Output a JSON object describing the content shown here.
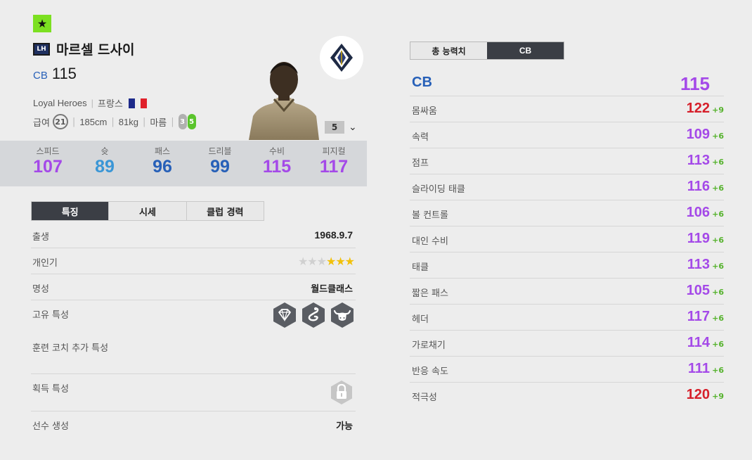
{
  "colors": {
    "red": "#d61f2a",
    "purple": "#a449e8",
    "blue": "#2760b8",
    "green": "#55b22c",
    "dark_tab": "#3b3e45"
  },
  "player": {
    "star_badge": "★",
    "season_code": "LH",
    "name": "마르셀 드사이",
    "position": "CB",
    "ovr": "115",
    "season_name": "Loyal Heroes",
    "nation": "프랑스",
    "wage_label": "급여",
    "wage": "21",
    "height": "185cm",
    "weight": "81kg",
    "build": "마름",
    "weak_foot": "3",
    "strong_foot": "5",
    "level": "5"
  },
  "summary_stats": [
    {
      "label": "스피드",
      "value": "107",
      "color": "#a449e8"
    },
    {
      "label": "슛",
      "value": "89",
      "color": "#3a96d6"
    },
    {
      "label": "패스",
      "value": "96",
      "color": "#2760b8"
    },
    {
      "label": "드리블",
      "value": "99",
      "color": "#2760b8"
    },
    {
      "label": "수비",
      "value": "115",
      "color": "#a449e8"
    },
    {
      "label": "피지컬",
      "value": "117",
      "color": "#a449e8"
    }
  ],
  "left_tabs": [
    "특징",
    "시세",
    "클럽 경력"
  ],
  "details": {
    "birth_label": "출생",
    "birth_value": "1968.9.7",
    "popularity_label": "개인기",
    "popularity_stars": 3,
    "popularity_max": 6,
    "reputation_label": "명성",
    "reputation_value": "월드클래스",
    "unique_trait_label": "고유 특성",
    "unique_trait_icons": [
      "diamond-icon",
      "snake-icon",
      "bull-icon"
    ],
    "coach_trait_label": "훈련 코치 추가 특성",
    "acquired_trait_label": "획득 특성",
    "generation_label": "선수 생성",
    "generation_value": "가능"
  },
  "right_tabs": [
    "총 능력치",
    "CB"
  ],
  "position_ovr": {
    "label": "CB",
    "value": "115"
  },
  "attributes": [
    {
      "label": "몸싸움",
      "value": "122",
      "bonus": "+9",
      "color": "#d61f2a"
    },
    {
      "label": "속력",
      "value": "109",
      "bonus": "+6",
      "color": "#a449e8"
    },
    {
      "label": "점프",
      "value": "113",
      "bonus": "+6",
      "color": "#a449e8"
    },
    {
      "label": "슬라이딩 태클",
      "value": "116",
      "bonus": "+6",
      "color": "#a449e8"
    },
    {
      "label": "볼 컨트롤",
      "value": "106",
      "bonus": "+6",
      "color": "#a449e8"
    },
    {
      "label": "대인 수비",
      "value": "119",
      "bonus": "+6",
      "color": "#a449e8"
    },
    {
      "label": "태클",
      "value": "113",
      "bonus": "+6",
      "color": "#a449e8"
    },
    {
      "label": "짧은 패스",
      "value": "105",
      "bonus": "+6",
      "color": "#a449e8"
    },
    {
      "label": "헤더",
      "value": "117",
      "bonus": "+6",
      "color": "#a449e8"
    },
    {
      "label": "가로채기",
      "value": "114",
      "bonus": "+6",
      "color": "#a449e8"
    },
    {
      "label": "반응 속도",
      "value": "111",
      "bonus": "+6",
      "color": "#a449e8"
    },
    {
      "label": "적극성",
      "value": "120",
      "bonus": "+9",
      "color": "#d61f2a"
    }
  ]
}
